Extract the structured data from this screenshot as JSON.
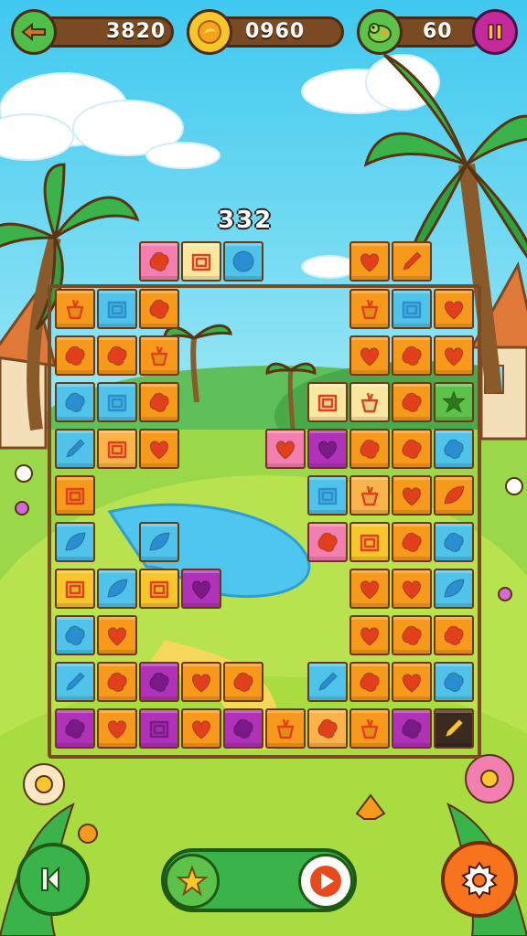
{
  "hud": {
    "coins_left": "3820",
    "coins_mid": "0960",
    "moves": "60",
    "score_top": "332"
  },
  "icons": {
    "back": "back-arrow-icon",
    "coin": "coin-icon",
    "turtle": "turtle-icon",
    "pause": "pause-icon",
    "restart": "restart-icon",
    "star": "star-icon",
    "play": "play-icon",
    "settings": "gear-icon"
  },
  "colors": {
    "orange": "#f79a1c",
    "orange_light": "#fbb44a",
    "blue": "#4fc3ea",
    "pink": "#f37fb0",
    "purple": "#b032b8",
    "yellow": "#f7c62a",
    "cream": "#fbe8a0",
    "green": "#5dc24a",
    "dark": "#3a2a20"
  }
}
